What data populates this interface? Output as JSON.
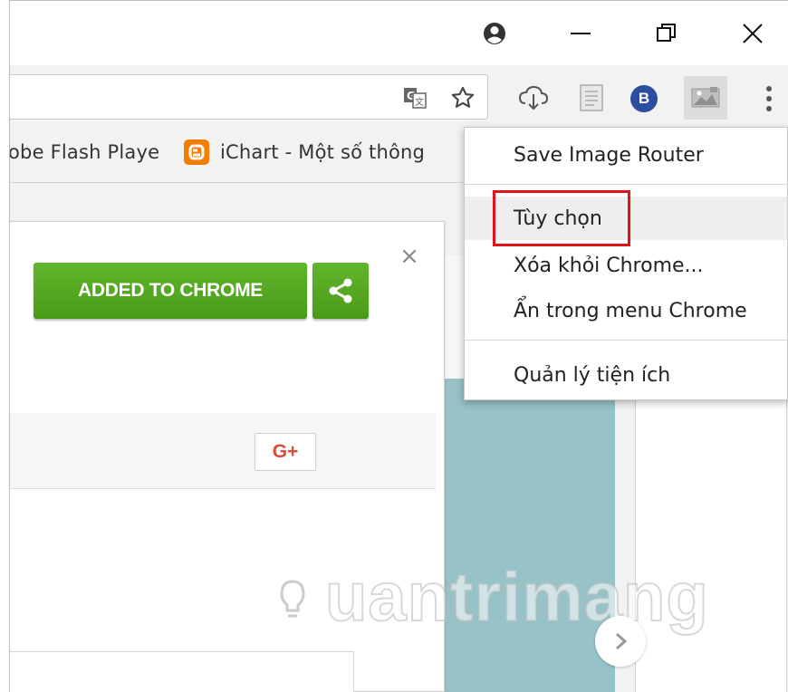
{
  "window": {
    "controls": [
      "account-icon",
      "minimize-icon",
      "restore-icon",
      "close-icon"
    ]
  },
  "toolbar": {
    "icons": [
      "translate-icon",
      "star-icon",
      "cloud-download-icon",
      "reader-icon",
      "b-extension-icon",
      "save-image-router-icon",
      "more-vert-icon"
    ],
    "b_extension_label": "B"
  },
  "bookmarks": {
    "items": [
      {
        "label": "obe Flash Playe",
        "icon": null
      },
      {
        "label": "iChart - Một số thông",
        "icon": "blogger-icon"
      }
    ]
  },
  "extension_card": {
    "added_label": "ADDED TO CHROME",
    "close_label": "×",
    "gplus_label": "G+"
  },
  "watermark": {
    "text": "uantrimang"
  },
  "context_menu": {
    "title": "Save Image Router",
    "items": [
      {
        "label": "Tùy chọn",
        "highlighted": true
      },
      {
        "label": "Xóa khỏi Chrome...",
        "highlighted": false
      },
      {
        "label": "Ẩn trong menu Chrome",
        "highlighted": false
      },
      {
        "label": "Quản lý tiện ích",
        "highlighted": false
      }
    ]
  },
  "colors": {
    "green_button": "#54a61f",
    "highlight_red": "#e3131b",
    "b_badge": "#2b4f9e",
    "blogger_orange": "#f57d00",
    "teal_panel": "#97c2c8"
  }
}
